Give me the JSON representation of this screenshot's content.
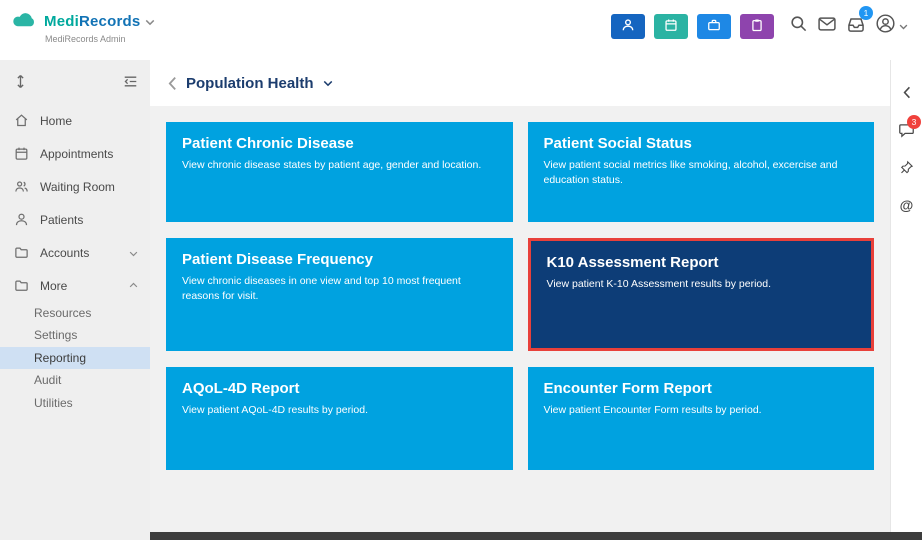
{
  "colors": {
    "card_blue": "#00a2e0",
    "card_navy": "#0d3d77",
    "highlight_red": "#e8403a",
    "brand_teal": "#00a99d",
    "brand_blue": "#1273b5",
    "active_item_bg": "#cfe0f3",
    "notification_blue": "#2196f3",
    "notification_red": "#f0413c"
  },
  "topbar": {
    "brand_medi": "Medi",
    "brand_records": "Records",
    "subtitle": "MediRecords Admin",
    "inbox_badge": "1",
    "icons": [
      "cloud-logo",
      "person",
      "calendar",
      "briefcase",
      "clipboard",
      "search",
      "mail",
      "inbox-tray",
      "profile"
    ]
  },
  "sidebar": {
    "items": [
      {
        "label": "Home",
        "icon": "home-icon"
      },
      {
        "label": "Appointments",
        "icon": "calendar-icon"
      },
      {
        "label": "Waiting Room",
        "icon": "people-icon"
      },
      {
        "label": "Patients",
        "icon": "person-icon"
      },
      {
        "label": "Accounts",
        "icon": "folder-icon",
        "expandable": true
      },
      {
        "label": "More",
        "icon": "folder-icon",
        "expanded": true
      }
    ],
    "sub_items": [
      {
        "label": "Resources",
        "active": false
      },
      {
        "label": "Settings",
        "active": false
      },
      {
        "label": "Reporting",
        "active": true
      },
      {
        "label": "Audit",
        "active": false
      },
      {
        "label": "Utilities",
        "active": false
      }
    ]
  },
  "main": {
    "breadcrumb": "Population Health",
    "cards": [
      {
        "title": "Patient Chronic Disease",
        "description": "View chronic disease states by patient age, gender and location.",
        "highlighted": false
      },
      {
        "title": "Patient Social Status",
        "description": "View patient social metrics like smoking, alcohol, excercise and education status.",
        "highlighted": false
      },
      {
        "title": "Patient Disease Frequency",
        "description": "View chronic diseases in one view and top 10 most frequent reasons for visit.",
        "highlighted": false
      },
      {
        "title": "K10 Assessment Report",
        "description": "View patient K-10 Assessment results by period.",
        "highlighted": true
      },
      {
        "title": "AQoL-4D Report",
        "description": "View patient AQoL-4D results by period.",
        "highlighted": false
      },
      {
        "title": "Encounter Form Report",
        "description": "View patient Encounter Form results by period.",
        "highlighted": false
      }
    ]
  },
  "right_rail": {
    "chat_badge": "3",
    "icons": [
      "chevron-left",
      "chat-bubble",
      "pin",
      "at-mention"
    ]
  }
}
